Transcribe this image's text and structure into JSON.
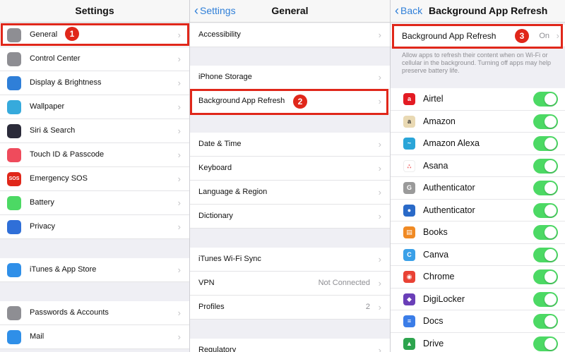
{
  "colors": {
    "accent": "#2f7fd8",
    "highlight": "#e0271a",
    "toggle_on": "#4cd964"
  },
  "settings": {
    "title": "Settings",
    "items": [
      {
        "label": "General",
        "icon": "gear-icon",
        "color": "#8e8e93"
      },
      {
        "label": "Control Center",
        "icon": "toggles-icon",
        "color": "#8e8e93"
      },
      {
        "label": "Display & Brightness",
        "icon": "text-size-icon",
        "color": "#2f7fd8"
      },
      {
        "label": "Wallpaper",
        "icon": "flower-icon",
        "color": "#36aadc"
      },
      {
        "label": "Siri & Search",
        "icon": "siri-icon",
        "color": "#2b2b3a"
      },
      {
        "label": "Touch ID & Passcode",
        "icon": "fingerprint-icon",
        "color": "#ef4b5c"
      },
      {
        "label": "Emergency SOS",
        "icon": "sos-icon",
        "color": "#e0271a",
        "glyph": "SOS"
      },
      {
        "label": "Battery",
        "icon": "battery-icon",
        "color": "#4cd964"
      },
      {
        "label": "Privacy",
        "icon": "hand-icon",
        "color": "#2f6fd8"
      },
      {
        "label": "iTunes & App Store",
        "icon": "app-store-icon",
        "color": "#2f8fe8"
      },
      {
        "label": "Passwords & Accounts",
        "icon": "key-icon",
        "color": "#8e8e93"
      },
      {
        "label": "Mail",
        "icon": "mail-icon",
        "color": "#2f8fe8"
      }
    ],
    "badge": "1"
  },
  "general": {
    "back_label": "Settings",
    "title": "General",
    "items": [
      {
        "label": "Accessibility",
        "value": ""
      },
      {
        "label": "iPhone Storage",
        "value": ""
      },
      {
        "label": "Background App Refresh",
        "value": ""
      },
      {
        "label": "Date & Time",
        "value": ""
      },
      {
        "label": "Keyboard",
        "value": ""
      },
      {
        "label": "Language & Region",
        "value": ""
      },
      {
        "label": "Dictionary",
        "value": ""
      },
      {
        "label": "iTunes Wi-Fi Sync",
        "value": ""
      },
      {
        "label": "VPN",
        "value": "Not Connected"
      },
      {
        "label": "Profiles",
        "value": "2"
      },
      {
        "label": "Regulatory",
        "value": ""
      }
    ],
    "badge": "2"
  },
  "bar": {
    "back_label": "Back",
    "title": "Background App Refresh",
    "setting_label": "Background App Refresh",
    "setting_value": "On",
    "description": "Allow apps to refresh their content when on Wi-Fi or cellular in the background. Turning off apps may help preserve battery life.",
    "badge": "3",
    "apps": [
      {
        "name": "Airtel",
        "icon": "airtel-icon",
        "color": "#e31b23",
        "glyph": "a",
        "on": true
      },
      {
        "name": "Amazon",
        "icon": "amazon-icon",
        "color": "#e9d9b3",
        "glyph": "a",
        "on": true
      },
      {
        "name": "Amazon Alexa",
        "icon": "alexa-icon",
        "color": "#2aa5d8",
        "glyph": "~",
        "on": true
      },
      {
        "name": "Asana",
        "icon": "asana-icon",
        "color": "#ffffff",
        "glyph": "∴",
        "on": true
      },
      {
        "name": "Authenticator",
        "icon": "google-authenticator-icon",
        "color": "#9a9a9a",
        "glyph": "G",
        "on": true
      },
      {
        "name": "Authenticator",
        "icon": "microsoft-authenticator-icon",
        "color": "#2a6ac8",
        "glyph": "●",
        "on": true
      },
      {
        "name": "Books",
        "icon": "books-icon",
        "color": "#f08a24",
        "glyph": "▤",
        "on": true
      },
      {
        "name": "Canva",
        "icon": "canva-icon",
        "color": "#3aa0e8",
        "glyph": "C",
        "on": true
      },
      {
        "name": "Chrome",
        "icon": "chrome-icon",
        "color": "#e94235",
        "glyph": "◉",
        "on": true
      },
      {
        "name": "DigiLocker",
        "icon": "digilocker-icon",
        "color": "#6a3fb8",
        "glyph": "◆",
        "on": true
      },
      {
        "name": "Docs",
        "icon": "docs-icon",
        "color": "#3b7de8",
        "glyph": "≡",
        "on": true
      },
      {
        "name": "Drive",
        "icon": "drive-icon",
        "color": "#2da44e",
        "glyph": "▲",
        "on": true
      }
    ]
  }
}
